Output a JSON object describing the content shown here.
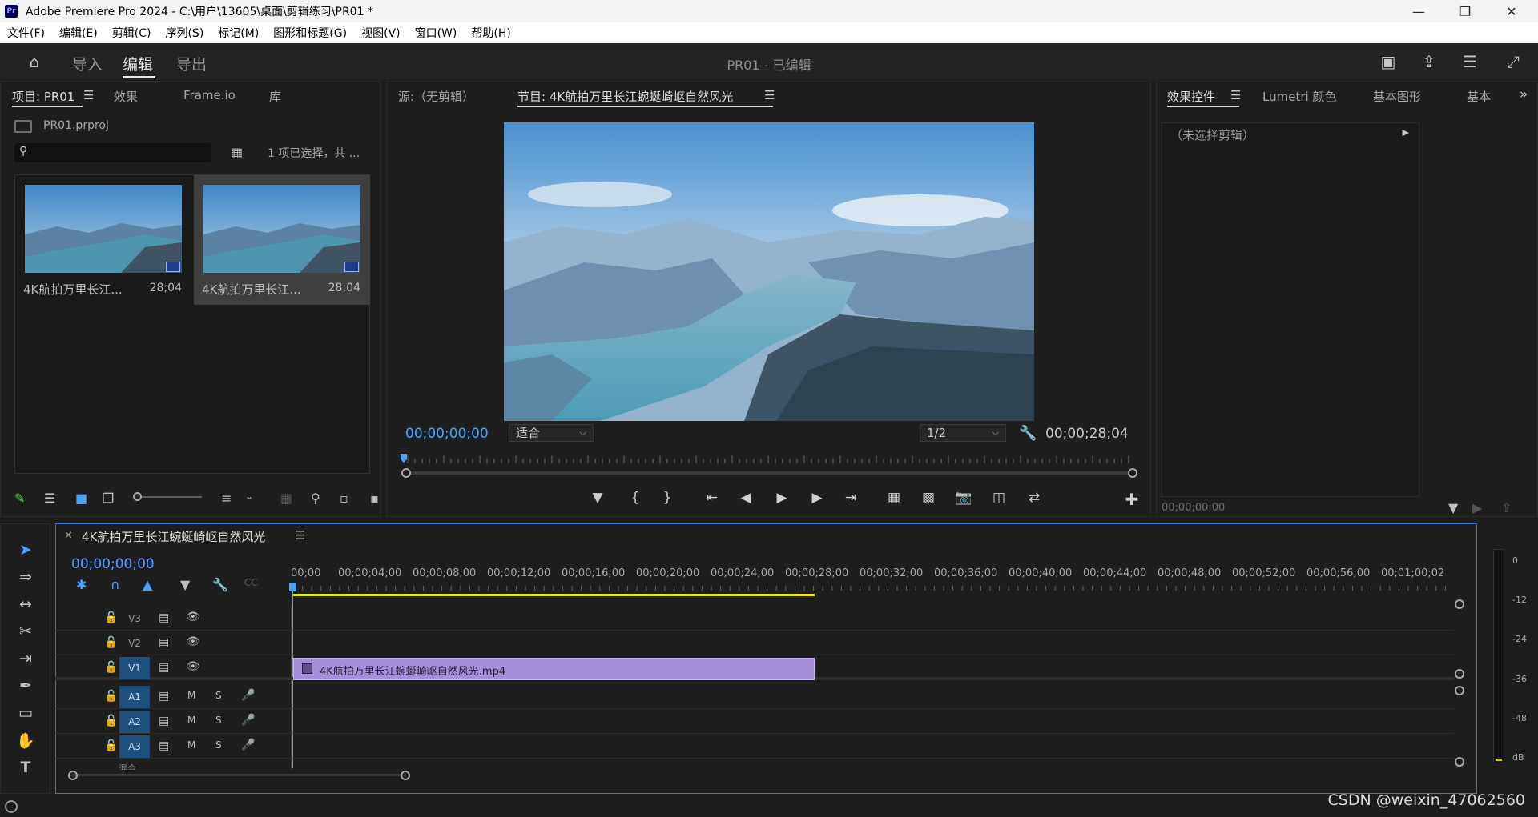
{
  "window": {
    "title": "Adobe Premiere Pro 2024 - C:\\用户\\13605\\桌面\\剪辑练习\\PR01 *",
    "logo": "Pr",
    "controls": [
      "minimize-icon",
      "restore-icon",
      "close-icon"
    ]
  },
  "menu": [
    "文件(F)",
    "编辑(E)",
    "剪辑(C)",
    "序列(S)",
    "标记(M)",
    "图形和标题(G)",
    "视图(V)",
    "窗口(W)",
    "帮助(H)"
  ],
  "header": {
    "workspaces": [
      "导入",
      "编辑",
      "导出"
    ],
    "active_workspace": "编辑",
    "project_title": "PR01 - 已编辑",
    "icons": [
      "quick-export-icon",
      "share-icon",
      "workspace-menu-icon",
      "fullscreen-icon"
    ]
  },
  "project_panel": {
    "tabs": [
      "项目: PR01",
      "效果",
      "Frame.io",
      "库"
    ],
    "active_tab": "项目: PR01",
    "project_file": "PR01.prproj",
    "search_placeholder": "",
    "selection_status": "1 项已选择，共 ...",
    "items": [
      {
        "name": "4K航拍万里长江...",
        "duration": "28;04",
        "selected": false,
        "badge": "video-icon"
      },
      {
        "name": "4K航拍万里长江...",
        "duration": "28;04",
        "selected": true,
        "badge": "sequence-icon"
      }
    ]
  },
  "source_monitor": {
    "tab": "源:（无剪辑）"
  },
  "program_monitor": {
    "tab": "节目: 4K航拍万里长江蜿蜒崎岖自然风光",
    "current_timecode": "00;00;00;00",
    "fit": "适合",
    "resolution": "1/2",
    "duration_timecode": "00;00;28;04",
    "controls": [
      "marker-icon",
      "in-point-icon",
      "out-point-icon",
      "go-to-in-icon",
      "step-back-icon",
      "play-icon",
      "step-forward-icon",
      "go-to-out-icon",
      "lift-icon",
      "extract-icon",
      "export-frame-icon",
      "compare-icon",
      "proxy-icon",
      "add-button-icon"
    ]
  },
  "effect_controls": {
    "tabs": [
      "效果控件",
      "Lumetri 颜色",
      "基本图形",
      "基本"
    ],
    "active_tab": "效果控件",
    "no_clip": "（未选择剪辑）",
    "timecode": "00;00;00;00"
  },
  "timeline": {
    "sequence_name": "4K航拍万里长江蜿蜒崎岖自然风光",
    "timecode": "00;00;00;00",
    "ruler": [
      "00;00",
      "00;00;04;00",
      "00;00;08;00",
      "00;00;12;00",
      "00;00;16;00",
      "00;00;20;00",
      "00;00;24;00",
      "00;00;28;00",
      "00;00;32;00",
      "00;00;36;00",
      "00;00;40;00",
      "00;00;44;00",
      "00;00;48;00",
      "00;00;52;00",
      "00;00;56;00",
      "00;01;00;02"
    ],
    "video_tracks": [
      "V3",
      "V2",
      "V1"
    ],
    "audio_tracks": [
      "A1",
      "A2",
      "A3"
    ],
    "audio_track_buttons": [
      "M",
      "S"
    ],
    "clip_name": "4K航拍万里长江蜿蜒崎岖自然风光.mp4",
    "master_label": "混合"
  },
  "audio_meter": {
    "labels": [
      "0",
      "-12",
      "-24",
      "-36",
      "-48",
      "dB"
    ]
  },
  "watermark": "CSDN @weixin_47062560"
}
